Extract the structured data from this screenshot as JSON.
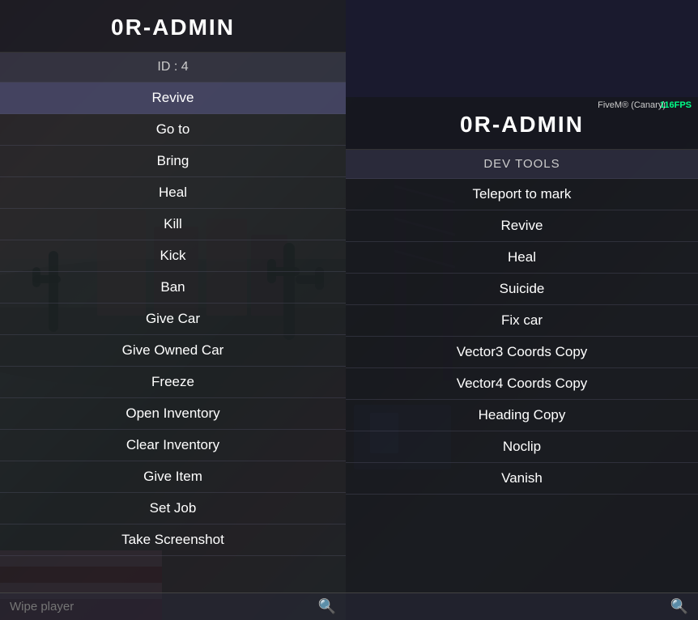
{
  "left_panel": {
    "title": "0R-ADMIN",
    "id_label": "ID : 4",
    "menu_items": [
      {
        "label": "Revive",
        "active": true
      },
      {
        "label": "Go to",
        "active": false
      },
      {
        "label": "Bring",
        "active": false
      },
      {
        "label": "Heal",
        "active": false
      },
      {
        "label": "Kill",
        "active": false
      },
      {
        "label": "Kick",
        "active": false
      },
      {
        "label": "Ban",
        "active": false
      },
      {
        "label": "Give Car",
        "active": false
      },
      {
        "label": "Give Owned Car",
        "active": false
      },
      {
        "label": "Freeze",
        "active": false
      },
      {
        "label": "Open Inventory",
        "active": false
      },
      {
        "label": "Clear Inventory",
        "active": false
      },
      {
        "label": "Give Item",
        "active": false
      },
      {
        "label": "Set Job",
        "active": false
      },
      {
        "label": "Take Screenshot",
        "active": false
      }
    ],
    "search_placeholder": "Wipe player",
    "search_icon": "🔍"
  },
  "right_panel": {
    "title": "0R-ADMIN",
    "fps": "116FPS",
    "fivem_label": "FiveM® (Canary)",
    "section_header": "DEV TOOLS",
    "menu_items": [
      {
        "label": "Teleport to mark",
        "active": false
      },
      {
        "label": "Revive",
        "active": false
      },
      {
        "label": "Heal",
        "active": false
      },
      {
        "label": "Suicide",
        "active": false
      },
      {
        "label": "Fix car",
        "active": false
      },
      {
        "label": "Vector3 Coords Copy",
        "active": false
      },
      {
        "label": "Vector4 Coords Copy",
        "active": false
      },
      {
        "label": "Heading Copy",
        "active": false
      },
      {
        "label": "Noclip",
        "active": false
      },
      {
        "label": "Vanish",
        "active": false
      }
    ],
    "search_placeholder": "",
    "search_icon": "🔍"
  }
}
